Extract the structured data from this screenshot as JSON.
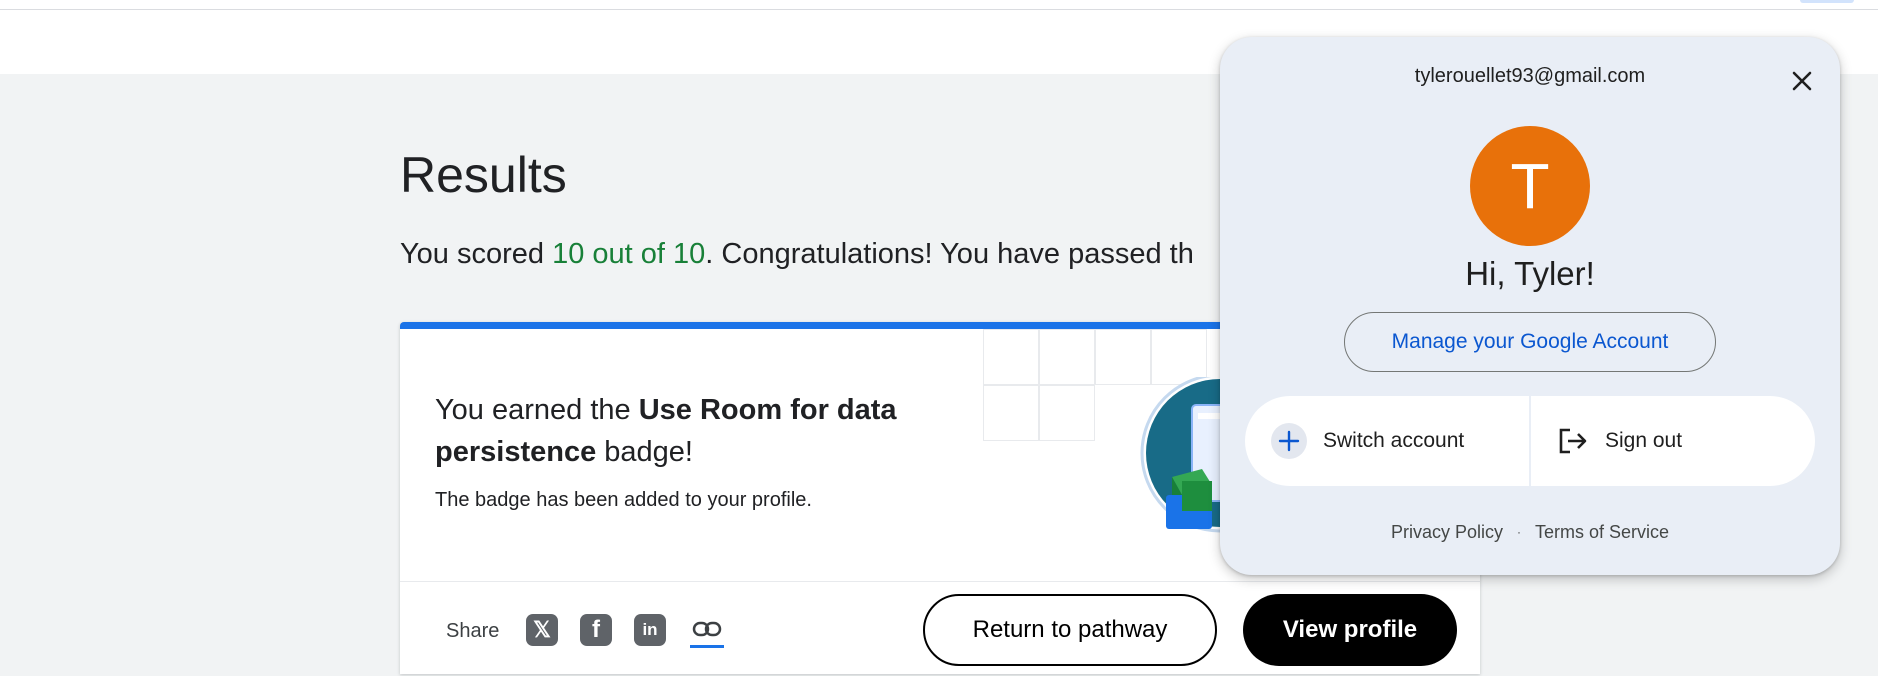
{
  "results": {
    "title": "Results",
    "score_prefix": "You scored ",
    "score": "10 out of 10",
    "score_suffix": ". Congratulations! You have passed th"
  },
  "badge": {
    "earned_prefix": "You earned the ",
    "badge_name": "Use Room for data persistence",
    "earned_suffix": " badge!",
    "added_text": "The badge has been added to your profile."
  },
  "share": {
    "label": "Share",
    "icons": [
      "x-icon",
      "facebook-icon",
      "linkedin-icon",
      "link-icon"
    ]
  },
  "buttons": {
    "return_label": "Return to pathway",
    "view_profile_label": "View profile"
  },
  "account": {
    "email": "tylerouellet93@gmail.com",
    "avatar_letter": "T",
    "avatar_color": "#e8710a",
    "greeting": "Hi, Tyler!",
    "manage_label": "Manage your Google Account",
    "switch_label": "Switch account",
    "signout_label": "Sign out",
    "privacy_label": "Privacy Policy",
    "separator": "·",
    "terms_label": "Terms of Service"
  },
  "colors": {
    "score_green": "#188038",
    "accent_blue": "#1a73e8",
    "link_blue": "#0b57d0"
  }
}
